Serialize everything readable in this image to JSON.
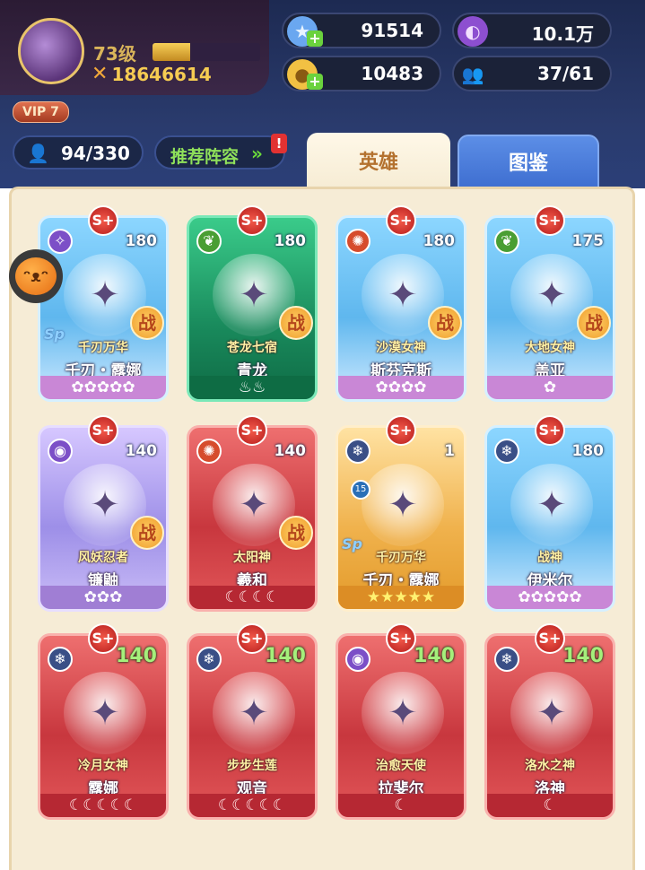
{
  "player": {
    "level": "73级",
    "power": "18646614",
    "vip": "VIP 7",
    "exp_fraction": 0.35
  },
  "resources": {
    "star_gem": "91514",
    "purple_currency": "10.1万",
    "gold_coin": "10483",
    "friends": "37/61"
  },
  "heroes_header": {
    "hero_count": "94/330",
    "recommend_label": "推荐阵容",
    "alert_mark": "!",
    "tab_heroes": "英雄",
    "tab_codex": "图鉴"
  },
  "cards": [
    {
      "theme": "blue",
      "element": "void",
      "element_icon": "✧",
      "level": "180",
      "title": "千刃万华",
      "name": "千刃・露娜",
      "stars": "✿✿✿✿✿",
      "battle": "战",
      "sp": "Sp",
      "emblem": "S+"
    },
    {
      "theme": "green",
      "element": "nature",
      "element_icon": "❦",
      "level": "180",
      "title": "苍龙七宿",
      "name": "青龙",
      "stars": "♨♨",
      "battle": "战",
      "emblem": "S+"
    },
    {
      "theme": "blue",
      "element": "fire",
      "element_icon": "✺",
      "level": "180",
      "title": "沙漠女神",
      "name": "斯芬克斯",
      "stars": "✿✿✿✿",
      "battle": "战",
      "emblem": "S+"
    },
    {
      "theme": "blue",
      "element": "nature",
      "element_icon": "❦",
      "level": "175",
      "title": "大地女神",
      "name": "盖亚",
      "stars": "✿",
      "battle": "战",
      "emblem": "S+"
    },
    {
      "theme": "purple",
      "element": "void",
      "element_icon": "◉",
      "level": "140",
      "title": "风妖忍者",
      "name": "镰鼬",
      "stars": "✿✿✿",
      "battle": "战",
      "emblem": "S+"
    },
    {
      "theme": "red",
      "element": "fire",
      "element_icon": "✺",
      "level": "140",
      "title": "太阳神",
      "name": "羲和",
      "stars": "☾☾☾☾",
      "battle": "战",
      "emblem": "S+"
    },
    {
      "theme": "gold",
      "element": "ice",
      "element_icon": "❄",
      "level": "1",
      "title": "千刃万华",
      "name": "千刃・露娜",
      "stars": "★★★★★",
      "sp": "Sp",
      "badge": "15",
      "emblem": "S+"
    },
    {
      "theme": "blue",
      "element": "ice",
      "element_icon": "❄",
      "level": "180",
      "title": "战神",
      "name": "伊米尔",
      "stars": "✿✿✿✿✿",
      "emblem": "S+"
    },
    {
      "theme": "red",
      "element": "ice",
      "element_icon": "❄",
      "level": "140",
      "title": "冷月女神",
      "name": "露娜",
      "stars": "☾☾☾☾☾",
      "emblem": "S+"
    },
    {
      "theme": "red",
      "element": "ice",
      "element_icon": "❄",
      "level": "140",
      "title": "步步生莲",
      "name": "观音",
      "stars": "☾☾☾☾☾",
      "emblem": "S+"
    },
    {
      "theme": "red",
      "element": "void",
      "element_icon": "◉",
      "level": "140",
      "title": "治愈天使",
      "name": "拉斐尔",
      "stars": "☾",
      "emblem": "S+"
    },
    {
      "theme": "red",
      "element": "ice",
      "element_icon": "❄",
      "level": "140",
      "title": "洛水之神",
      "name": "洛神",
      "stars": "☾",
      "emblem": "S+"
    }
  ],
  "colors": {
    "panel_bg": "#f6ecd6",
    "tab_active_text": "#b4722f",
    "level_green": "#a5ef7b"
  }
}
